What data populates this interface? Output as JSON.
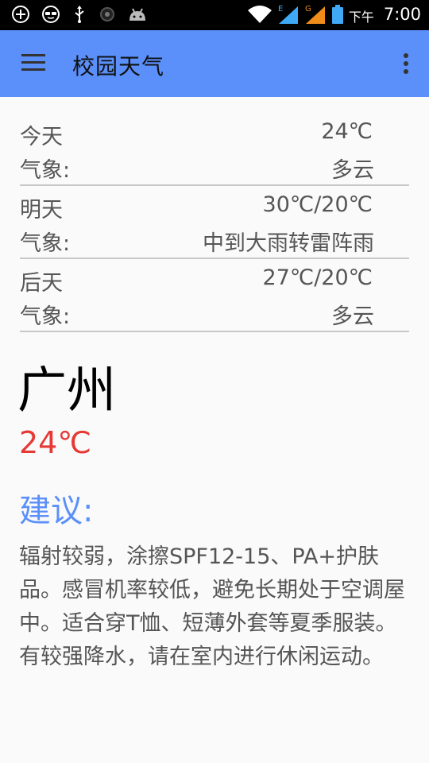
{
  "status_bar": {
    "time": "7:00",
    "ampm": "下午",
    "icons": [
      "plus-circle-icon",
      "sunglasses-icon",
      "usb-icon",
      "record-icon",
      "android-icon",
      "wifi-icon",
      "signal-e-icon",
      "signal-g-icon",
      "battery-icon"
    ]
  },
  "app_bar": {
    "title": "校园天气",
    "left_icon": "menu-icon",
    "right_icon": "overflow-menu-icon",
    "color": "#5b8ff9"
  },
  "forecast": [
    {
      "day": "今天",
      "temp": "24℃",
      "weather_label": "气象:",
      "weather": "多云"
    },
    {
      "day": "明天",
      "temp": "30℃/20℃",
      "weather_label": "气象:",
      "weather": "中到大雨转雷阵雨"
    },
    {
      "day": "后天",
      "temp": "27℃/20℃",
      "weather_label": "气象:",
      "weather": "多云"
    }
  ],
  "current": {
    "city": "广州",
    "temp": "24℃",
    "temp_color": "#e53935"
  },
  "advice": {
    "heading": "建议:",
    "heading_color": "#5b8ff9",
    "text": "辐射较弱，涂擦SPF12-15、PA+护肤品。感冒机率较低，避免长期处于空调屋中。适合穿T恤、短薄外套等夏季服装。有较强降水，请在室内进行休闲运动。"
  }
}
